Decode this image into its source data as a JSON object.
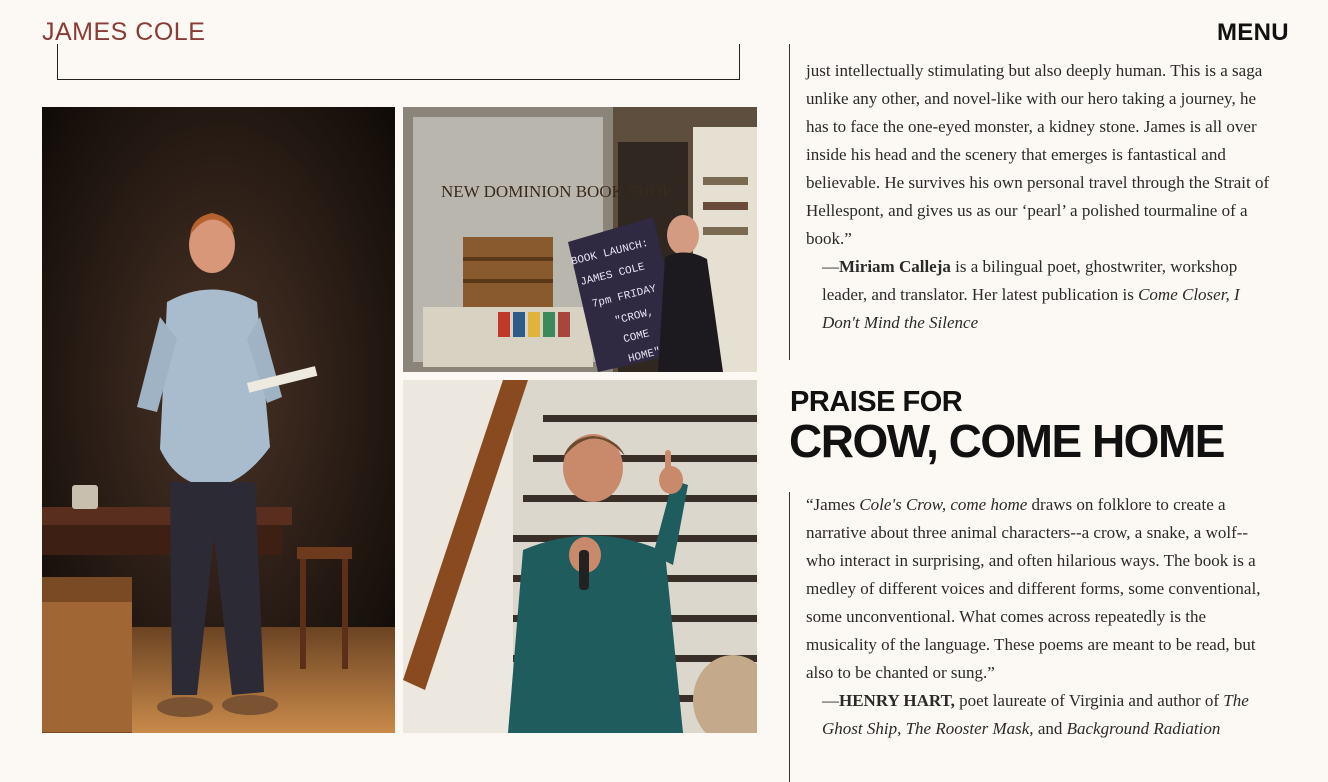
{
  "header": {
    "site_title": "JAMES COLE",
    "menu_label": "MENU"
  },
  "gallery": {
    "photo_a_alt": "James Cole reading on stage",
    "photo_b_alt": "Book launch sign at New Dominion Book Shop",
    "photo_c_alt": "James Cole reading with a microphone",
    "shop_sign": "NEW DOMINION BOOK SHOP",
    "chalkboard_lines": [
      "BOOK LAUNCH:",
      "JAMES COLE",
      "7pm FRIDAY",
      "\"CROW,",
      "COME",
      "HOME\""
    ]
  },
  "review_1": {
    "lines": [
      "just intellectually stimulating but also deeply human. This is a saga",
      "unlike any other, and novel-like with our hero taking a journey, he",
      "has to face the one-eyed monster, a kidney stone. James is all over",
      "inside his head and the scenery that emerges is fantastical and",
      "believable. He survives his own personal travel through the Strait of",
      "Hellespont, and gives us as our ‘pearl’ a polished tourmaline of a",
      "book.”"
    ],
    "attrib_dash": "—",
    "attrib_name": "Miriam Calleja",
    "attrib_text": " is a bilingual poet, ghostwriter, workshop leader, and translator. Her latest publication is ",
    "attrib_title": "Come Closer, I Don't Mind the Silence"
  },
  "section": {
    "heading_small": "PRAISE FOR",
    "heading_big": "CROW, COME HOME"
  },
  "review_2": {
    "open": "“James ",
    "title_italic": "Cole's Crow, come home",
    "body": " draws on folklore to create a narrative about three animal characters--a crow, a snake, a wolf--who interact in surprising, and often hilarious ways. The book is a medley of different voices and different forms, some conventional, some unconventional. What comes across repeatedly is the musicality of the language. These poems are meant to be read, but also to be chanted or sung.”",
    "attrib_dash": "—",
    "attrib_name": "HENRY HART,",
    "attrib_text": " poet laureate of Virginia and author of ",
    "work_1": "The Ghost Ship,",
    "work_2": "The Rooster Mask,",
    "and_text": " and ",
    "work_3": "Background Radiation"
  }
}
